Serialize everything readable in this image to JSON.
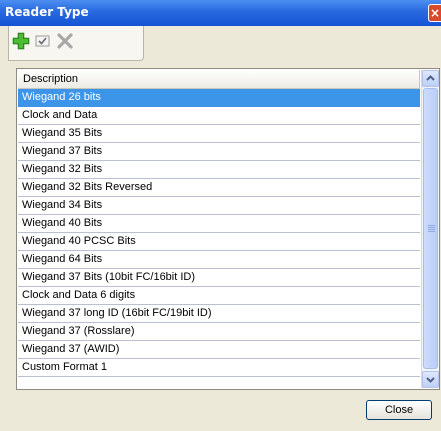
{
  "window": {
    "title": "Reader Type",
    "close_glyph": "×"
  },
  "toolbar": {
    "add_icon": "plus-icon",
    "edit_icon": "edit-check-icon",
    "delete_icon": "delete-x-icon"
  },
  "grid": {
    "column_header": "Description",
    "selected_index": 0,
    "rows": [
      "Wiegand 26 bits",
      "Clock and Data",
      "Wiegand 35 Bits",
      "Wiegand 37 Bits",
      "Wiegand 32 Bits",
      "Wiegand 32 Bits Reversed",
      "Wiegand 34 Bits",
      "Wiegand 40 Bits",
      "Wiegand 40 PCSC Bits",
      "Wiegand 64 Bits",
      "Wiegand 37 Bits (10bit FC/16bit ID)",
      "Clock and Data 6 digits",
      "Wiegand 37 long ID (16bit FC/19bit ID)",
      "Wiegand 37 (Rosslare)",
      "Wiegand 37 (AWID)",
      "Custom Format 1"
    ]
  },
  "footer": {
    "close_label": "Close"
  },
  "colors": {
    "titlebar": "#1553d5",
    "selection": "#3d95ea",
    "dialog_bg": "#ece9d8"
  }
}
